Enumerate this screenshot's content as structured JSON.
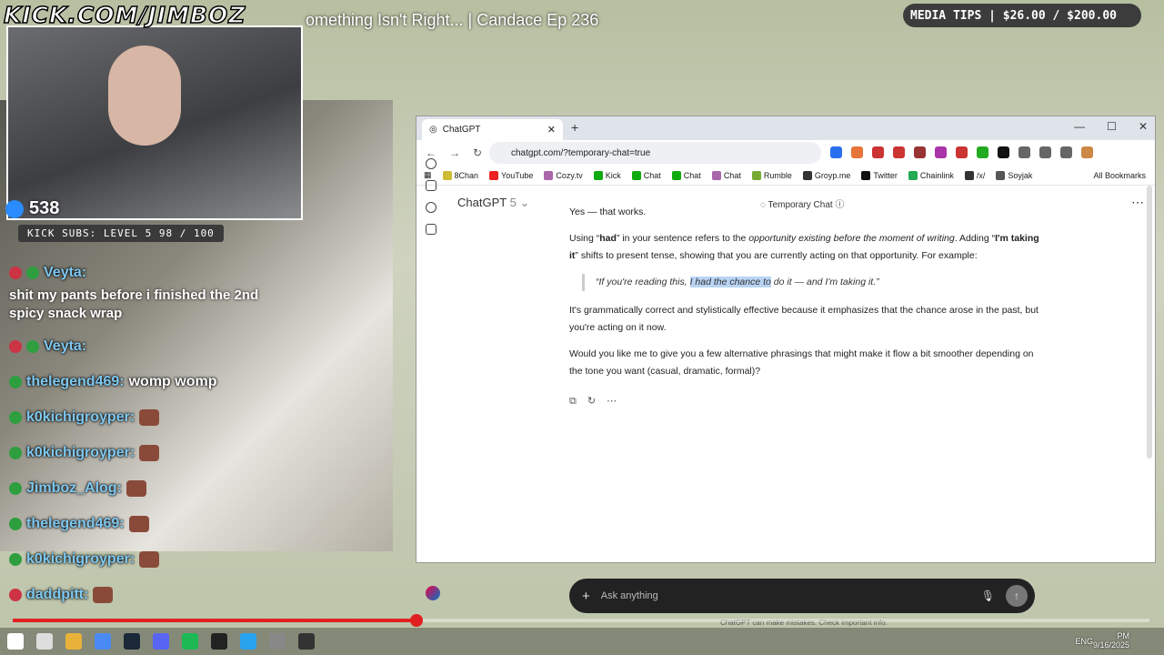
{
  "overlay": {
    "brand": "KICK.COM/JIMBOZ",
    "video_title": "omething Isn't Right... | Candace Ep 236",
    "viewers": "538",
    "subs": "KICK SUBS: LEVEL 5 98 / 100",
    "media_tips": "MEDIA TIPS | $26.00 / $200.00"
  },
  "chat": [
    {
      "name": "Veyta:",
      "msg": ""
    },
    {
      "name": "Veyta:",
      "msg": ""
    },
    {
      "name": "thelegend469:",
      "msg": "womp womp"
    },
    {
      "name": "k0kichigroyper:",
      "msg": ""
    },
    {
      "name": "k0kichigroyper:",
      "msg": ""
    },
    {
      "name": "Jimboz_Alog:",
      "msg": ""
    },
    {
      "name": "thelegend469:",
      "msg": ""
    },
    {
      "name": "k0kichigroyper:",
      "msg": ""
    },
    {
      "name": "daddpitt:",
      "msg": ""
    }
  ],
  "chat_big_msg": "shit my pants before i finished the 2nd spicy snack wrap",
  "browser": {
    "tab_title": "ChatGPT",
    "url": "chatgpt.com/?temporary-chat=true",
    "bookmarks": [
      "8Chan",
      "YouTube",
      "Cozy.tv",
      "Kick",
      "Chat",
      "Chat",
      "Chat",
      "Rumble",
      "Groyp.me",
      "Twitter",
      "Chainlink",
      "/x/",
      "Soyjak"
    ],
    "all_bookmarks": "All Bookmarks"
  },
  "chatgpt": {
    "title": "ChatGPT",
    "version": "5",
    "temp_chat": "Temporary Chat",
    "p1": "Yes — that works.",
    "p2a": "Using “",
    "p2_had": "had",
    "p2b": "” in your sentence refers to the ",
    "p2_italic": "opportunity existing before the moment of writing",
    "p2c": ". Adding “",
    "p2_bold": "I'm taking it",
    "p2d": "” shifts to present tense, showing that you are currently acting on that opportunity. For example:",
    "quote_a": "“If you're reading this, ",
    "quote_hl": "I had the chance to",
    "quote_b": " do it — and I'm taking it.”",
    "p3": "It's grammatically correct and stylistically effective because it emphasizes that the chance arose in the past, but you're acting on it now.",
    "p4": "Would you like me to give you a few alternative phrasings that might make it flow a bit smoother depending on the tone you want (casual, dramatic, formal)?",
    "composer_placeholder": "Ask anything",
    "disclaimer": "ChatGPT can make mistakes. Check important info."
  },
  "player": {
    "progress": 0.355
  },
  "tray": {
    "lang": "ENG",
    "time": "PM",
    "date": "9/16/2025"
  }
}
